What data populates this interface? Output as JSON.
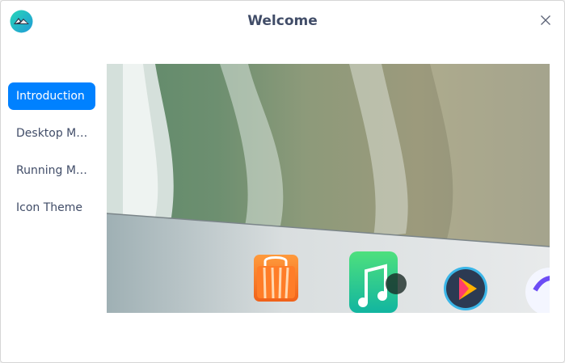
{
  "window": {
    "title": "Welcome",
    "app_icon": "deepin-logo-icon",
    "close_icon": "close-icon"
  },
  "sidebar": {
    "items": [
      {
        "label": "Introduction",
        "active": true
      },
      {
        "label": "Desktop Mo...",
        "active": false
      },
      {
        "label": "Running Mo...",
        "active": false
      },
      {
        "label": "Icon Theme",
        "active": false
      }
    ]
  },
  "preview": {
    "description_icons": [
      "app-store-icon",
      "music-icon",
      "video-player-icon",
      "browser-icon"
    ]
  },
  "colors": {
    "accent": "#0081ff",
    "text": "#414d68"
  }
}
